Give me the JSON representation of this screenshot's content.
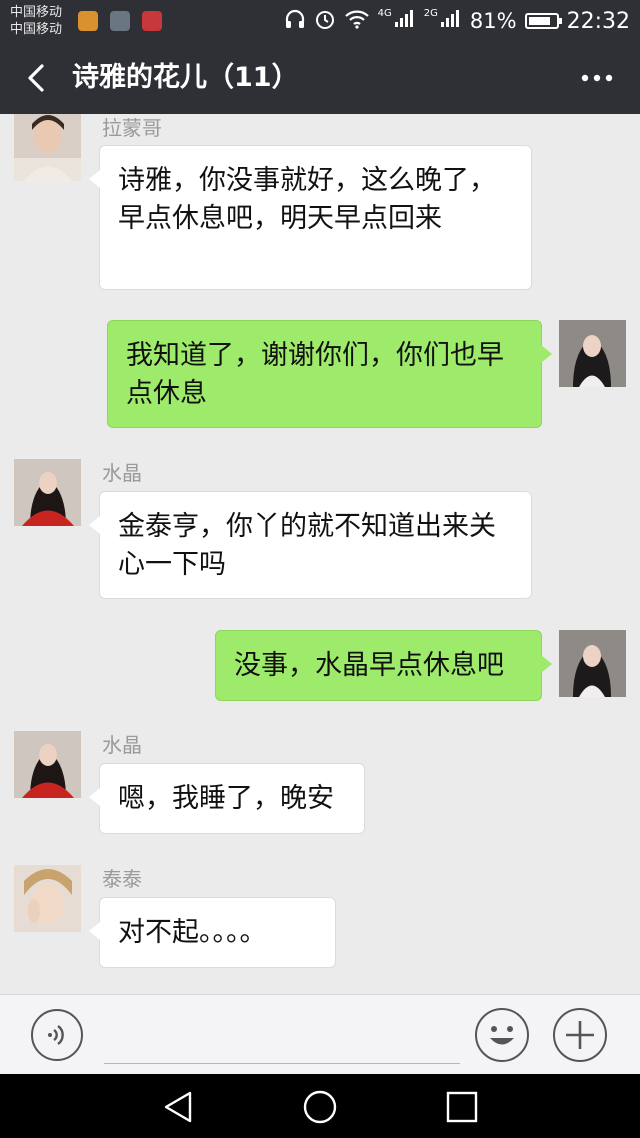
{
  "status_bar": {
    "carrier_1": "中国移动",
    "carrier_2": "中国移动",
    "net_4g": "4G",
    "net_2g": "2G",
    "battery_percent": "81%",
    "battery_level": 0.81,
    "time": "22:32"
  },
  "header": {
    "title": "诗雅的花儿（11）",
    "back_icon": "chevron-left-icon",
    "more_icon": "more-dots-icon"
  },
  "messages": [
    {
      "sender": "拉蒙哥",
      "text": "诗雅，你没事就好，这么晚了，早点休息吧，明天早点回来",
      "direction": "in"
    },
    {
      "sender": "",
      "text": "我知道了，谢谢你们，你们也早点休息",
      "direction": "out"
    },
    {
      "sender": "水晶",
      "text": "金泰亨，你丫的就不知道出来关心一下吗",
      "direction": "in"
    },
    {
      "sender": "",
      "text": "没事，水晶早点休息吧",
      "direction": "out"
    },
    {
      "sender": "水晶",
      "text": "嗯，我睡了，晚安",
      "direction": "in"
    },
    {
      "sender": "泰泰",
      "text": "对不起。。。。",
      "direction": "in"
    }
  ],
  "input_bar": {
    "voice_icon": "voice-icon",
    "input_value": "",
    "emoji_icon": "emoji-icon",
    "plus_icon": "plus-icon"
  },
  "colors": {
    "header_bg": "#2f3035",
    "chat_bg": "#ebebeb",
    "outgoing_bubble": "#9eea6a",
    "incoming_bubble": "#ffffff"
  }
}
